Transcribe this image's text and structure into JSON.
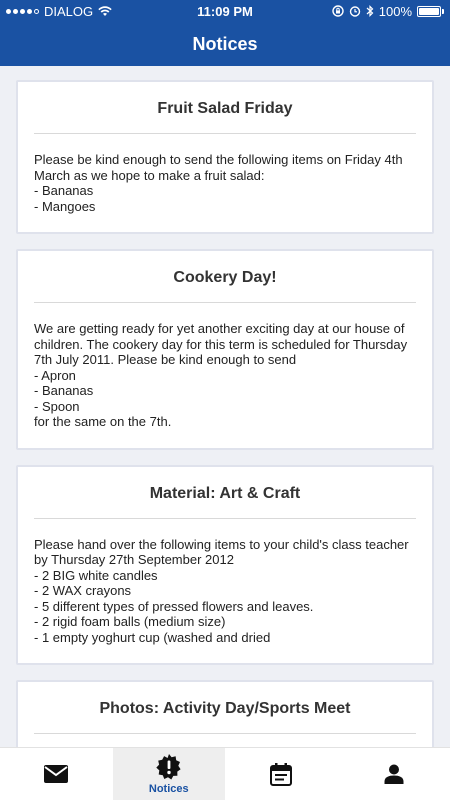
{
  "status_bar": {
    "carrier": "DIALOG",
    "time": "11:09 PM",
    "battery": "100%",
    "icons": [
      "signal-dots-icon",
      "wifi-icon",
      "lock-rotation-icon",
      "alarm-icon",
      "bluetooth-icon",
      "battery-icon"
    ]
  },
  "header": {
    "title": "Notices"
  },
  "notices": [
    {
      "title": "Fruit Salad Friday",
      "lines": [
        "Please be kind enough to send the following items on Friday 4th March as we hope to make a fruit salad:",
        "- Bananas",
        "- Mangoes"
      ]
    },
    {
      "title": "Cookery Day!",
      "lines": [
        "We are getting ready for yet another exciting day at our house of children. The cookery day for this term is scheduled for Thursday 7th July 2011. Please be kind enough to send",
        "- Apron",
        "- Bananas",
        "- Spoon",
        "for the same on the 7th."
      ]
    },
    {
      "title": "Material: Art & Craft",
      "lines": [
        "Please hand over the following items to your child's class teacher by Thursday 27th September 2012",
        "- 2 BIG white candles",
        "- 2 WAX crayons",
        "- 5 different types of pressed flowers and leaves.",
        "- 2 rigid foam balls (medium size)",
        "- 1 empty yoghurt cup (washed and dried"
      ]
    },
    {
      "title": "Photos: Activity Day/Sports Meet",
      "lines": []
    }
  ],
  "tabbar": {
    "tabs": [
      {
        "icon": "envelope-icon",
        "label": ""
      },
      {
        "icon": "alert-badge-icon",
        "label": "Notices",
        "active": true
      },
      {
        "icon": "calendar-icon",
        "label": ""
      },
      {
        "icon": "person-icon",
        "label": ""
      }
    ]
  },
  "colors": {
    "brand": "#1a52a3",
    "background": "#eef0f5",
    "card_border": "#dfe2ec",
    "active_tab": "#eeeeee"
  }
}
